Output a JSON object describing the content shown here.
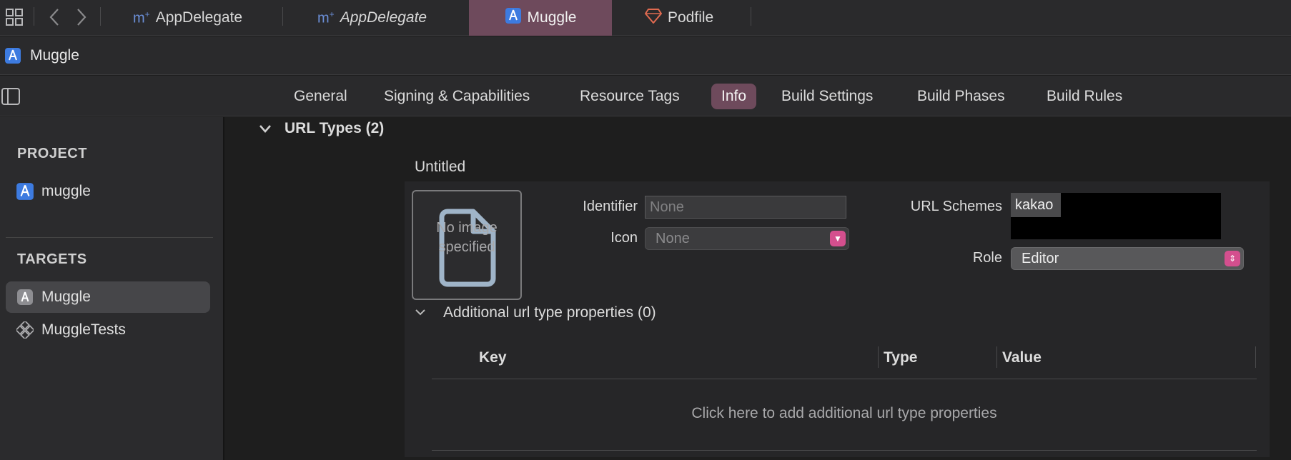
{
  "file_tabs": [
    {
      "label": "AppDelegate",
      "icon": "m-swift-file-icon",
      "italic": false
    },
    {
      "label": "AppDelegate",
      "icon": "m-swift-file-icon",
      "italic": true
    },
    {
      "label": "Muggle",
      "icon": "xcode-project-icon",
      "active": true
    },
    {
      "label": "Podfile",
      "icon": "ruby-gem-icon"
    }
  ],
  "project_bar": {
    "name": "Muggle"
  },
  "editor_tabs": [
    {
      "label": "General"
    },
    {
      "label": "Signing & Capabilities"
    },
    {
      "label": "Resource Tags"
    },
    {
      "label": "Info",
      "active": true
    },
    {
      "label": "Build Settings"
    },
    {
      "label": "Build Phases"
    },
    {
      "label": "Build Rules"
    }
  ],
  "sidebar": {
    "project_header": "PROJECT",
    "project_items": [
      {
        "label": "muggle"
      }
    ],
    "targets_header": "TARGETS",
    "target_items": [
      {
        "label": "Muggle",
        "selected": true
      },
      {
        "label": "MuggleTests"
      }
    ]
  },
  "url_types": {
    "section_title": "URL Types (2)",
    "entry_title": "Untitled",
    "image_placeholder": "No image specified",
    "identifier_label": "Identifier",
    "identifier_placeholder": "None",
    "icon_label": "Icon",
    "icon_value": "None",
    "url_schemes_label": "URL Schemes",
    "url_schemes_value": "kakao",
    "role_label": "Role",
    "role_value": "Editor",
    "additional_title": "Additional url type properties (0)",
    "table_headers": {
      "key": "Key",
      "type": "Type",
      "value": "Value"
    },
    "add_hint": "Click here to add additional url type properties"
  },
  "colors": {
    "accent": "#6e4a5c",
    "popup_button": "#d44f8e",
    "background": "#1e1e1e"
  }
}
